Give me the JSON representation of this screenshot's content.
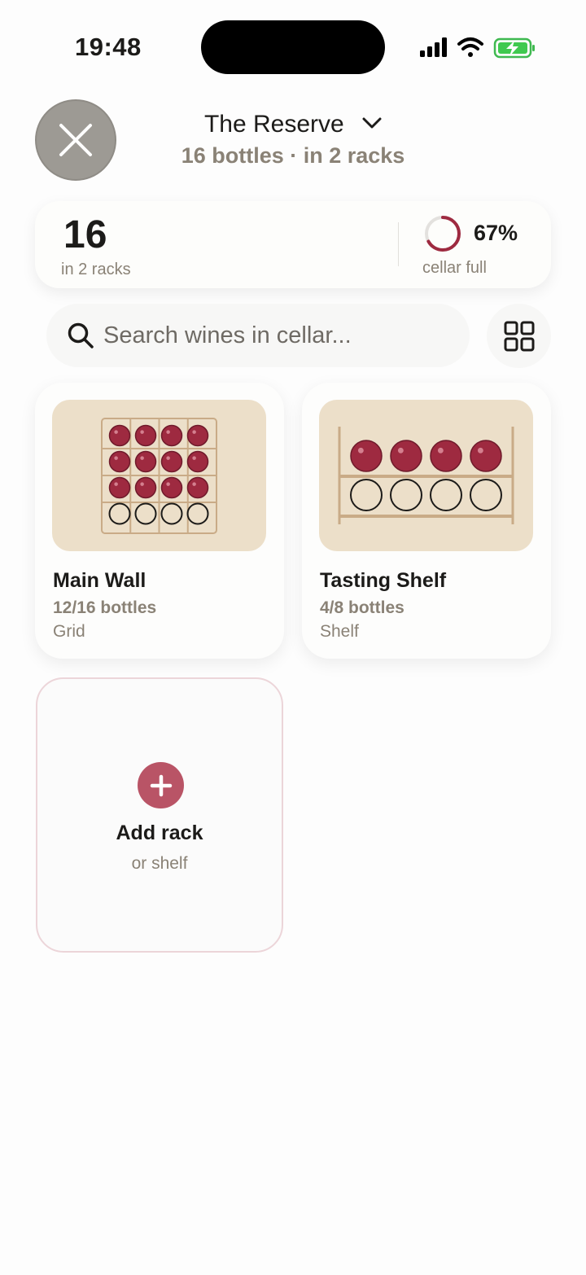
{
  "status": {
    "time": "19:48"
  },
  "header": {
    "title": "The Reserve",
    "subtitle": "16 bottles · in 2 racks"
  },
  "summary": {
    "count": "16",
    "count_label": "in 2 racks",
    "fill_percent": "67%",
    "fill_fraction": 0.67,
    "fill_label": "cellar full"
  },
  "search": {
    "placeholder": "Search wines in cellar..."
  },
  "racks": [
    {
      "name": "Main Wall",
      "count": "12/16 bottles",
      "type": "Grid",
      "filled": 12,
      "capacity": 16
    },
    {
      "name": "Tasting Shelf",
      "count": "4/8 bottles",
      "type": "Shelf",
      "filled": 4,
      "capacity": 8
    }
  ],
  "add_rack": {
    "title": "Add rack",
    "subtitle": "or shelf"
  },
  "colors": {
    "wine": "#9e2a40",
    "accent_pink": "#b95466",
    "muted_text": "#8a8276",
    "thumb_bg": "#ecdfc9",
    "wood": "#c9ab87"
  },
  "icons": {
    "close": "close-icon",
    "chevron": "chevron-down-icon",
    "search": "search-icon",
    "view_toggle": "grid-view-icon",
    "add": "plus-icon"
  }
}
